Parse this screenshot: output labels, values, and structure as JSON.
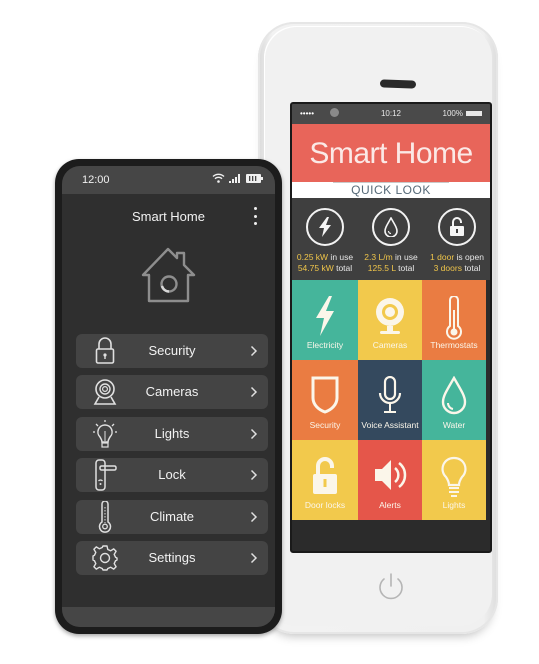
{
  "dark_phone": {
    "status": {
      "time": "12:00",
      "icons": [
        "wifi-icon",
        "signal-icon",
        "battery-icon"
      ]
    },
    "header": {
      "title": "Smart Home",
      "menu_icon": "more-vertical-icon"
    },
    "hero_icon": "house-icon",
    "menu_items": [
      {
        "label": "Security",
        "icon": "padlock-icon"
      },
      {
        "label": "Cameras",
        "icon": "webcam-icon"
      },
      {
        "label": "Lights",
        "icon": "lightbulb-icon"
      },
      {
        "label": "Lock",
        "icon": "door-handle-icon"
      },
      {
        "label": "Climate",
        "icon": "thermometer-icon"
      },
      {
        "label": "Settings",
        "icon": "gear-icon"
      }
    ]
  },
  "white_phone": {
    "status": {
      "signal_dots": "•••••",
      "time": "10:12",
      "battery": "100%"
    },
    "title": "Smart Home",
    "subtitle": "QUICK LOOK",
    "stats": [
      {
        "icon": "lightning-icon",
        "line1_value": "0.25 kW",
        "line1_text": " in use",
        "line2_value": "54.75 kW",
        "line2_text": " total"
      },
      {
        "icon": "water-drop-icon",
        "line1_value": "2.3 L/m",
        "line1_text": " in use",
        "line2_value": "125.5 L",
        "line2_text": " total"
      },
      {
        "icon": "unlocked-icon",
        "line1_value": "1 door",
        "line1_text": " is open",
        "line2_value": "3 doors",
        "line2_text": " total"
      }
    ],
    "tiles": [
      {
        "label": "Electricity",
        "icon": "lightning-icon",
        "color": "#45b59b"
      },
      {
        "label": "Cameras",
        "icon": "webcam-icon",
        "color": "#f2c94c"
      },
      {
        "label": "Thermostats",
        "icon": "thermometer-icon",
        "color": "#ea7c42"
      },
      {
        "label": "Security",
        "icon": "shield-icon",
        "color": "#ea7c42"
      },
      {
        "label": "Voice Assistant",
        "icon": "microphone-icon",
        "color": "#34495e"
      },
      {
        "label": "Water",
        "icon": "water-drop-icon",
        "color": "#45b59b"
      },
      {
        "label": "Door locks",
        "icon": "unlocked-icon",
        "color": "#f2c94c"
      },
      {
        "label": "Alerts",
        "icon": "speaker-icon",
        "color": "#e5564a"
      },
      {
        "label": "Lights",
        "icon": "lightbulb-icon",
        "color": "#f2c94c"
      }
    ],
    "home_button_icon": "power-icon"
  },
  "colors": {
    "title_bar": "#e8655a",
    "stat_highlight": "#efc54a",
    "dark_screen": "#2f2f2f",
    "dark_menu_item": "#444444"
  }
}
